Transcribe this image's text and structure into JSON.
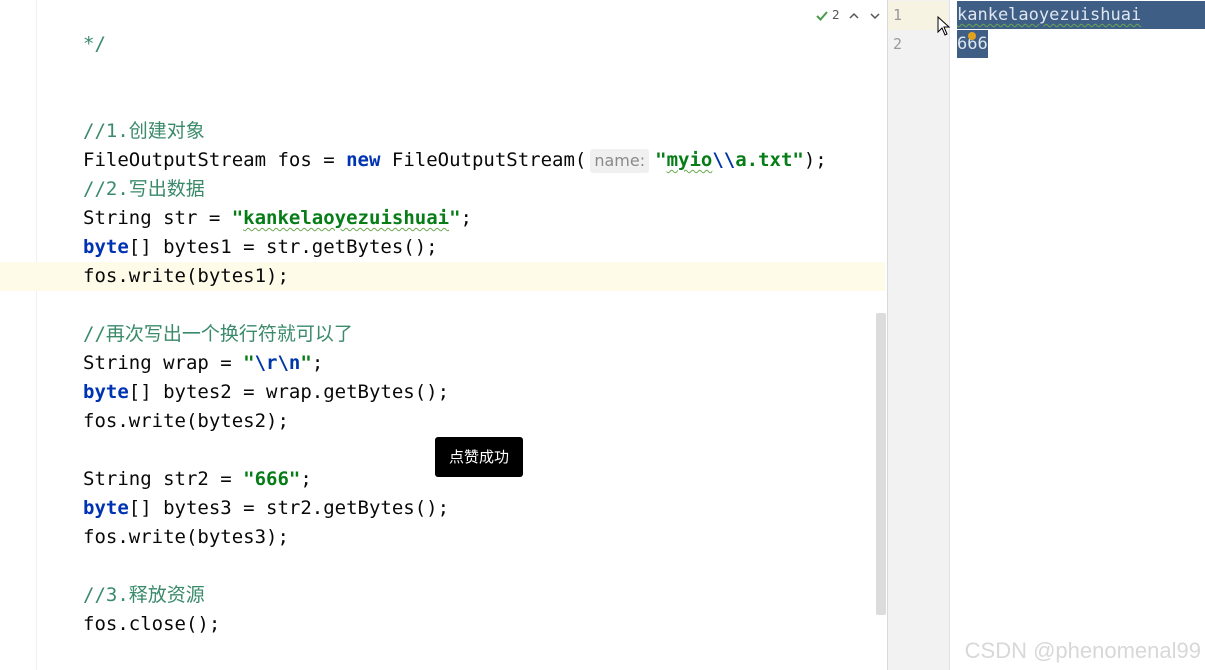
{
  "editor": {
    "lines": {
      "l1": "*/",
      "l2": "//1.创建对象",
      "l3a": "FileOutputStream fos = ",
      "l3kw": "new",
      "l3b": " FileOutputStream(",
      "l3hint": "name:",
      "l3s1": "\"",
      "l3s2": "myio",
      "l3s3": "\\\\",
      "l3s4": "a.txt\"",
      "l3c": ");",
      "l4": "//2.写出数据",
      "l5a": "String str = ",
      "l5s1": "\"",
      "l5s2": "kankelaoyezuishuai",
      "l5s3": "\"",
      "l5c": ";",
      "l6kw": "byte",
      "l6b": "[] bytes1 = str.getBytes();",
      "l7": "fos.write(bytes1);",
      "l8": "//再次写出一个换行符就可以了",
      "l9a": "String wrap = ",
      "l9s1": "\"",
      "l9e": "\\r\\n",
      "l9s2": "\"",
      "l9c": ";",
      "l10kw": "byte",
      "l10b": "[] bytes2 = wrap.getBytes();",
      "l11": "fos.write(bytes2);",
      "l12a": "String str2 = ",
      "l12s": "\"666\"",
      "l12c": ";",
      "l13kw": "byte",
      "l13b": "[] bytes3 = str2.getBytes();",
      "l14": "fos.write(bytes3);",
      "l15": "//3.释放资源",
      "l16": "fos.close();"
    },
    "inspection": {
      "check_icon": "check-icon",
      "count": "2",
      "up_icon": "chevron-up-icon",
      "down_icon": "chevron-down-icon"
    }
  },
  "file_view": {
    "line_numbers": [
      "1",
      "2"
    ],
    "content": [
      "kankelaoyezuishuai",
      "666"
    ]
  },
  "toast": {
    "text": "点赞成功"
  },
  "watermark": {
    "text": "CSDN @phenomenal99"
  },
  "colors": {
    "keyword": "#0033b3",
    "string": "#067d17",
    "comment": "#3a8a6b",
    "selection": "#3f5e85",
    "current_line": "#fefbe9"
  }
}
